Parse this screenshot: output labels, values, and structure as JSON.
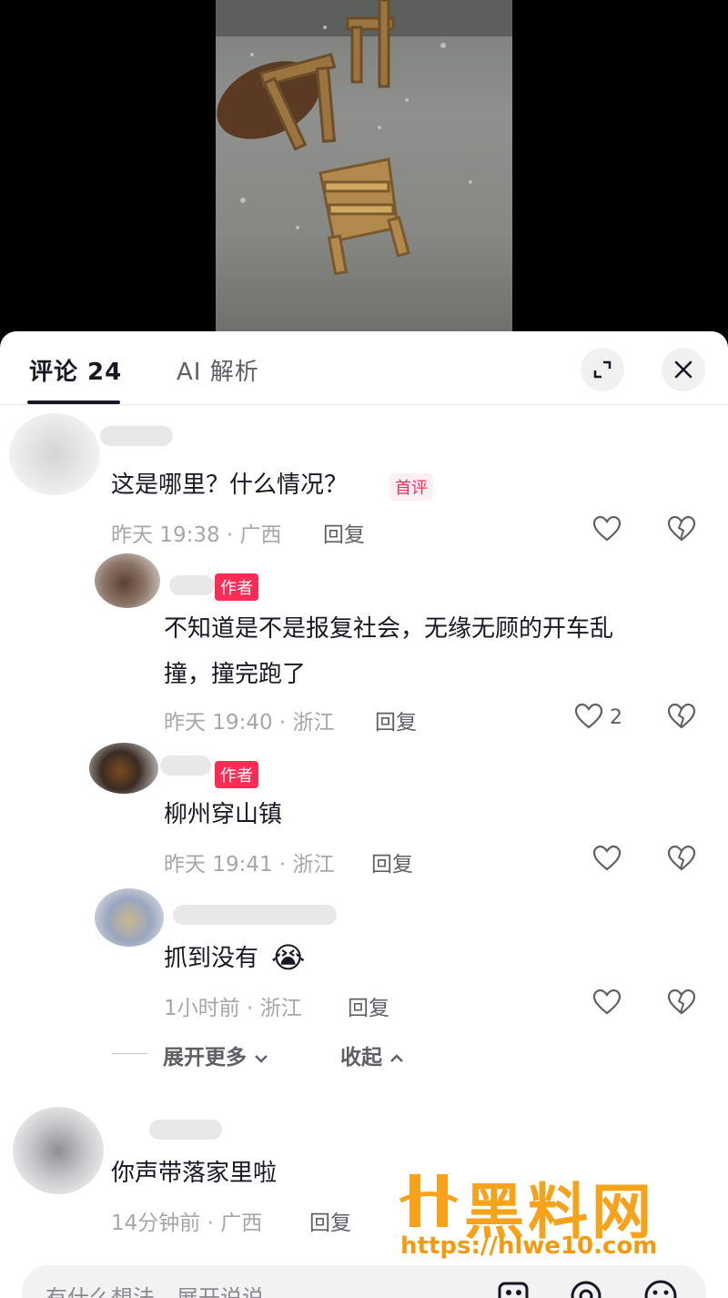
{
  "tabs": {
    "comments_label": "评论 24",
    "ai_label": "AI 解析"
  },
  "comments": [
    {
      "text": "这是哪里？什么情况？",
      "badge": "首评",
      "time_location": "昨天 19:38 · 广西",
      "reply_label": "回复"
    },
    {
      "author_badge": "作者",
      "text_line1": "不知道是不是报复社会，无缘无顾的开车乱",
      "text_line2": "撞，撞完跑了",
      "time_location": "昨天 19:40 · 浙江",
      "reply_label": "回复",
      "like_count": "2"
    },
    {
      "author_badge": "作者",
      "text": "柳州穿山镇",
      "time_location": "昨天 19:41 · 浙江",
      "reply_label": "回复"
    },
    {
      "text": "抓到没有",
      "emoji": "😭",
      "time_location": "1小时前 · 浙江",
      "reply_label": "回复"
    },
    {
      "text": "你声带落家里啦",
      "time_location": "14分钟前 · 广西",
      "reply_label": "回复"
    }
  ],
  "thread_controls": {
    "expand_more": "展开更多",
    "collapse": "收起"
  },
  "input": {
    "placeholder": "有什么想法，展开说说"
  },
  "watermark": {
    "title": "黑料网",
    "url": "https://hlwe10.com"
  },
  "icons": [
    "expand-icon",
    "close-icon",
    "heart-icon",
    "broken-heart-icon",
    "image-icon",
    "at-icon",
    "emoji-icon"
  ],
  "colors": {
    "accent": "#fe2c55",
    "watermark": "#f7a21b"
  }
}
